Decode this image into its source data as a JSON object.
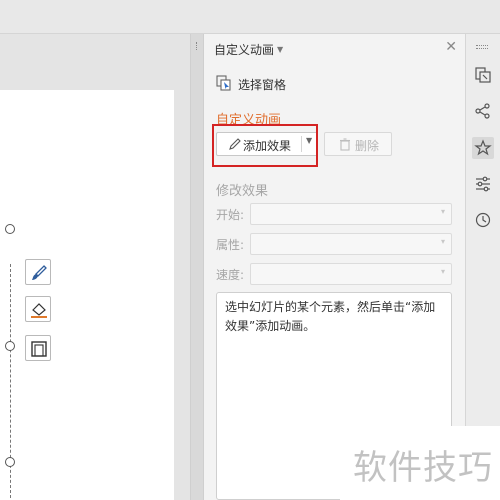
{
  "pane": {
    "title": "自定义动画",
    "select_pane_label": "选择窗格",
    "custom_animation_heading": "自定义动画",
    "add_effect_label": "添加效果",
    "delete_label": "删除",
    "modify_effect_heading": "修改效果",
    "fields": [
      {
        "label": "开始:",
        "value": ""
      },
      {
        "label": "属性:",
        "value": ""
      },
      {
        "label": "速度:",
        "value": ""
      }
    ],
    "description": "选中幻灯片的某个元素，然后单击“添加效果”添加动画。"
  },
  "sidebar_icons": [
    "slide-layout-icon",
    "share-icon",
    "animation-star-icon",
    "settings-sliders-icon",
    "history-icon"
  ],
  "watermark": "软件技巧",
  "colors": {
    "accent_orange": "#e06d2c",
    "highlight_red": "#d42323"
  }
}
